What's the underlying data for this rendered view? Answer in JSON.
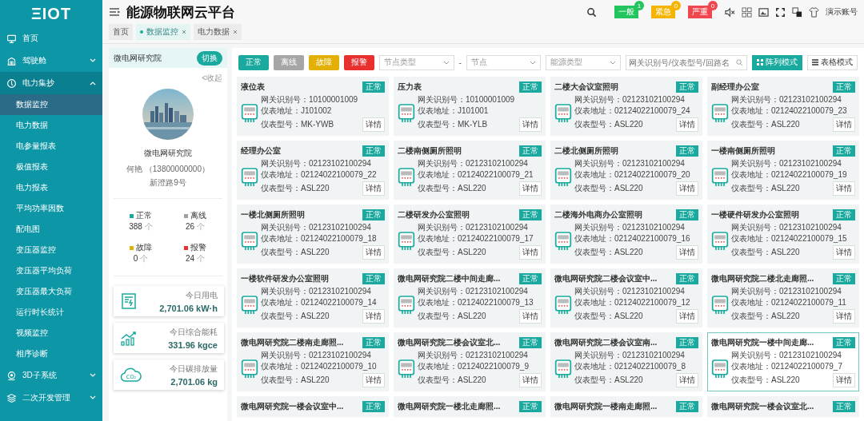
{
  "logo": "ΞIOT",
  "sidebar": {
    "items": [
      {
        "label": "首页"
      },
      {
        "label": "驾驶舱",
        "expanded": false
      },
      {
        "label": "电力集抄",
        "expanded": true,
        "children": [
          {
            "label": "数据监控",
            "selected": true
          },
          {
            "label": "电力数据",
            "selected": false
          },
          {
            "label": "电参量报表",
            "selected": false
          },
          {
            "label": "极值报表",
            "selected": false
          },
          {
            "label": "电力报表",
            "selected": false
          },
          {
            "label": "平均功率因数",
            "selected": false
          },
          {
            "label": "配电图",
            "selected": false
          },
          {
            "label": "变压器监控",
            "selected": false
          },
          {
            "label": "变压器平均负荷",
            "selected": false
          },
          {
            "label": "变压器最大负荷",
            "selected": false
          },
          {
            "label": "运行时长统计",
            "selected": false
          },
          {
            "label": "视频监控",
            "selected": false
          },
          {
            "label": "相序诊断",
            "selected": false
          }
        ]
      },
      {
        "label": "3D子系统",
        "expanded": false
      },
      {
        "label": "二次开发管理",
        "expanded": false
      }
    ]
  },
  "header": {
    "title": "能源物联网云平台",
    "alerts": [
      {
        "label": "一般",
        "count": "1",
        "color": "#22c55e"
      },
      {
        "label": "紧急",
        "count": "0",
        "color": "#f5b400"
      },
      {
        "label": "严重",
        "count": "0",
        "color": "#f0474f"
      }
    ],
    "user": "演示账号"
  },
  "tabs": [
    {
      "label": "首页",
      "selected": false,
      "closable": false
    },
    {
      "label": "数据监控",
      "selected": true,
      "closable": true
    },
    {
      "label": "电力数据",
      "selected": false,
      "closable": true
    }
  ],
  "site_panel": {
    "name": "微电网研究院",
    "switch_button": "切换",
    "collapse_link": "<收起",
    "title": "微电网研究院",
    "contact": "何艳 （13800000000）",
    "address": "新澄路9号",
    "stats": [
      {
        "label": "正常",
        "count": "388",
        "unit": "个",
        "color": "#1aa99e"
      },
      {
        "label": "离线",
        "count": "26",
        "unit": "个",
        "color": "#a0a0a0"
      },
      {
        "label": "故障",
        "count": "0",
        "unit": "个",
        "color": "#e2b007"
      },
      {
        "label": "报警",
        "count": "24",
        "unit": "个",
        "color": "#e8312f"
      }
    ],
    "kpis": [
      {
        "kind": "power",
        "label": "今日用电",
        "value": "2,701.06 kW·h"
      },
      {
        "kind": "energy",
        "label": "今日综合能耗",
        "value": "331.96 kgce"
      },
      {
        "kind": "carbon",
        "label": "今日碳排放量",
        "value": "2,701.06 kg",
        "icon_text": "CO₂"
      }
    ]
  },
  "toolbar": {
    "filters": [
      {
        "label": "正常",
        "color": "#1aa99e"
      },
      {
        "label": "离线",
        "color": "#a6a6a6"
      },
      {
        "label": "故障",
        "color": "#e2b007"
      },
      {
        "label": "报警",
        "color": "#e8312f"
      }
    ],
    "selects": [
      {
        "placeholder": "节点类型"
      },
      {
        "placeholder": "节点"
      },
      {
        "placeholder": "能源类型"
      }
    ],
    "separator": "-",
    "search": {
      "placeholder": "网关识别号/仪表型号/回路名"
    },
    "modes": [
      {
        "label": "阵列模式",
        "selected": true
      },
      {
        "label": "表格模式",
        "selected": false
      }
    ]
  },
  "cards": [
    {
      "title": "液位表",
      "status": "正常",
      "selected": false,
      "lines": [
        "网关识别号：10100001009",
        "仪表地址：J101002",
        "仪表型号：MK-YWB"
      ],
      "button": "详情"
    },
    {
      "title": "压力表",
      "status": "正常",
      "selected": false,
      "lines": [
        "网关识别号：10100001009",
        "仪表地址：J101001",
        "仪表型号：MK-YLB"
      ],
      "button": "详情"
    },
    {
      "title": "二楼大会议室照明",
      "status": "正常",
      "selected": false,
      "lines": [
        "网关识别号：02123102100294",
        "仪表地址：02124022100079_24",
        "仪表型号：ASL220"
      ],
      "button": "详情"
    },
    {
      "title": "副经理办公室",
      "status": "正常",
      "selected": false,
      "lines": [
        "网关识别号：02123102100294",
        "仪表地址：02124022100079_23",
        "仪表型号：ASL220"
      ],
      "button": "详情"
    },
    {
      "title": "经理办公室",
      "status": "正常",
      "selected": false,
      "lines": [
        "网关识别号：02123102100294",
        "仪表地址：02124022100079_22",
        "仪表型号：ASL220"
      ],
      "button": "详情"
    },
    {
      "title": "二楼南侧厕所照明",
      "status": "正常",
      "selected": false,
      "lines": [
        "网关识别号：02123102100294",
        "仪表地址：02124022100079_21",
        "仪表型号：ASL220"
      ],
      "button": "详情"
    },
    {
      "title": "二楼北侧厕所照明",
      "status": "正常",
      "selected": false,
      "lines": [
        "网关识别号：02123102100294",
        "仪表地址：02124022100079_20",
        "仪表型号：ASL220"
      ],
      "button": "详情"
    },
    {
      "title": "一楼南侧厕所照明",
      "status": "正常",
      "selected": false,
      "lines": [
        "网关识别号：02123102100294",
        "仪表地址：02124022100079_19",
        "仪表型号：ASL220"
      ],
      "button": "详情"
    },
    {
      "title": "一楼北侧厕所照明",
      "status": "正常",
      "selected": false,
      "lines": [
        "网关识别号：02123102100294",
        "仪表地址：02124022100079_18",
        "仪表型号：ASL220"
      ],
      "button": "详情"
    },
    {
      "title": "二楼研发办公室照明",
      "status": "正常",
      "selected": false,
      "lines": [
        "网关识别号：02123102100294",
        "仪表地址：02124022100079_17",
        "仪表型号：ASL220"
      ],
      "button": "详情"
    },
    {
      "title": "二楼海外电商办公室照明",
      "status": "正常",
      "selected": false,
      "lines": [
        "网关识别号：02123102100294",
        "仪表地址：02124022100079_16",
        "仪表型号：ASL220"
      ],
      "button": "详情"
    },
    {
      "title": "一楼硬件研发办公室照明",
      "status": "正常",
      "selected": false,
      "lines": [
        "网关识别号：02123102100294",
        "仪表地址：02124022100079_15",
        "仪表型号：ASL220"
      ],
      "button": "详情"
    },
    {
      "title": "一楼软件研发办公室照明",
      "status": "正常",
      "selected": false,
      "lines": [
        "网关识别号：02123102100294",
        "仪表地址：02124022100079_14",
        "仪表型号：ASL220"
      ],
      "button": "详情"
    },
    {
      "title": "微电网研究院二楼中间走廊...",
      "status": "正常",
      "selected": false,
      "lines": [
        "网关识别号：02123102100294",
        "仪表地址：02124022100079_13",
        "仪表型号：ASL220"
      ],
      "button": "详情"
    },
    {
      "title": "微电网研究院二楼会议室中...",
      "status": "正常",
      "selected": false,
      "lines": [
        "网关识别号：02123102100294",
        "仪表地址：02124022100079_12",
        "仪表型号：ASL220"
      ],
      "button": "详情"
    },
    {
      "title": "微电网研究院二楼北走廊照...",
      "status": "正常",
      "selected": false,
      "lines": [
        "网关识别号：02123102100294",
        "仪表地址：02124022100079_11",
        "仪表型号：ASL220"
      ],
      "button": "详情"
    },
    {
      "title": "微电网研究院二楼南走廊照...",
      "status": "正常",
      "selected": false,
      "lines": [
        "网关识别号：02123102100294",
        "仪表地址：02124022100079_10",
        "仪表型号：ASL220"
      ],
      "button": "详情"
    },
    {
      "title": "微电网研究院二楼会议室北...",
      "status": "正常",
      "selected": false,
      "lines": [
        "网关识别号：02123102100294",
        "仪表地址：02124022100079_9",
        "仪表型号：ASL220"
      ],
      "button": "详情"
    },
    {
      "title": "微电网研究院二楼会议室南...",
      "status": "正常",
      "selected": false,
      "lines": [
        "网关识别号：02123102100294",
        "仪表地址：02124022100079_8",
        "仪表型号：ASL220"
      ],
      "button": "详情"
    },
    {
      "title": "微电网研究院一楼中间走廊...",
      "status": "正常",
      "selected": true,
      "lines": [
        "网关识别号：02123102100294",
        "仪表地址：02124022100079_7",
        "仪表型号：ASL220"
      ],
      "button": "详情"
    },
    {
      "title": "微电网研究院一楼会议室中...",
      "status": "正常",
      "selected": false
    },
    {
      "title": "微电网研究院一楼北走廊照...",
      "status": "正常",
      "selected": false
    },
    {
      "title": "微电网研究院一楼南走廊照...",
      "status": "正常",
      "selected": false
    },
    {
      "title": "微电网研究院一楼会议室北...",
      "status": "正常",
      "selected": false
    }
  ]
}
